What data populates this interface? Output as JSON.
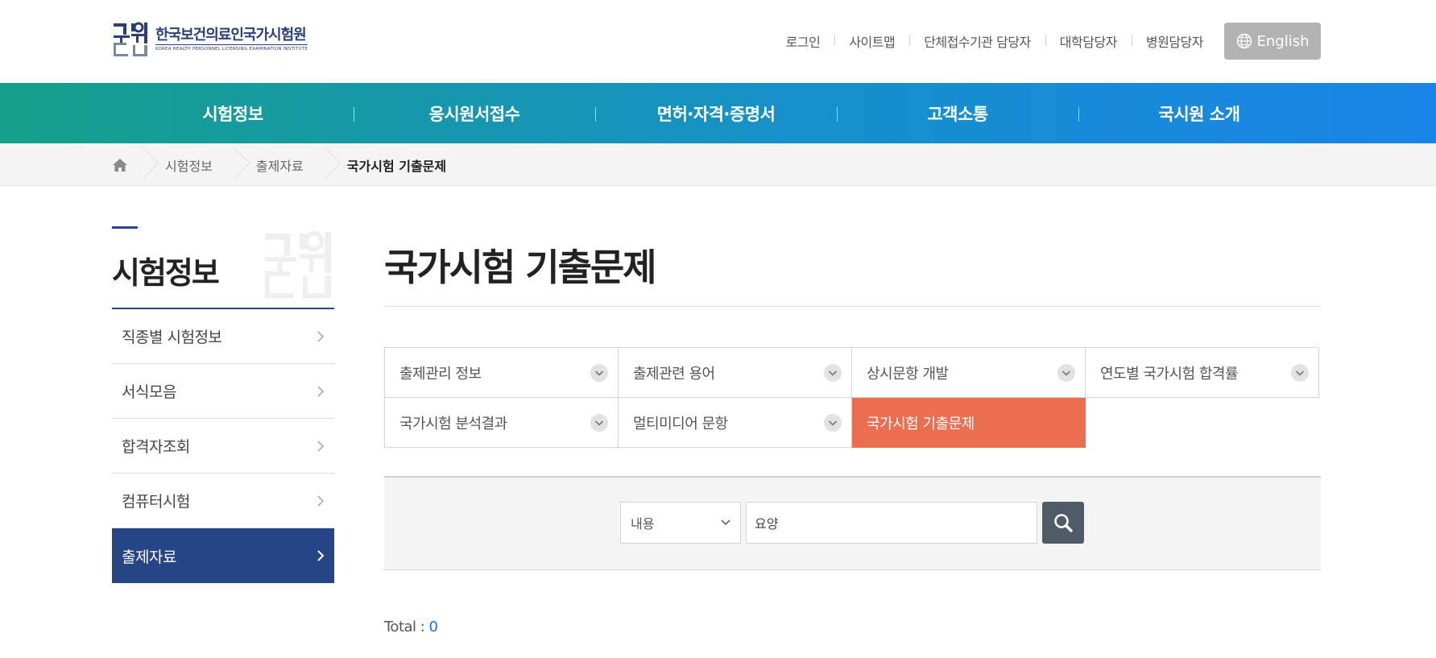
{
  "header": {
    "logo": {
      "name_kr": "한국보건의료인국가시험원",
      "name_en": "KOREA HEALTH PERSONNEL LICENSING EXAMINATION INSTITUTE",
      "mark": "국시원"
    },
    "util_links": [
      "로그인",
      "사이트맵",
      "단체접수기관 담당자",
      "대학담당자",
      "병원담당자"
    ],
    "english_label": "English"
  },
  "gnb": {
    "items": [
      "시험정보",
      "응시원서접수",
      "면허·자격·증명서",
      "고객소통",
      "국시원 소개"
    ]
  },
  "breadcrumb": {
    "items": [
      "시험정보",
      "출제자료",
      "국가시험 기출문제"
    ]
  },
  "lnb": {
    "title": "시험정보",
    "items": [
      {
        "label": "직종별 시험정보",
        "active": false
      },
      {
        "label": "서식모음",
        "active": false
      },
      {
        "label": "합격자조회",
        "active": false
      },
      {
        "label": "컴퓨터시험",
        "active": false
      },
      {
        "label": "출제자료",
        "active": true
      }
    ]
  },
  "main": {
    "page_title": "국가시험 기출문제",
    "tabs": [
      {
        "label": "출제관리 정보",
        "active": false
      },
      {
        "label": "출제관련 용어",
        "active": false
      },
      {
        "label": "상시문항 개발",
        "active": false
      },
      {
        "label": "연도별 국가시험 합격률",
        "active": false
      },
      {
        "label": "국가시험 분석결과",
        "active": false
      },
      {
        "label": "멀티미디어 문항",
        "active": false
      },
      {
        "label": "국가시험 기출문제",
        "active": true
      }
    ],
    "search": {
      "select_value": "내용",
      "input_value": "요양"
    },
    "total_label": "Total : ",
    "total_count": "0"
  },
  "colors": {
    "gnb_start": "#15a08a",
    "gnb_end": "#1a85e8",
    "lnb_active": "#264584",
    "tab_active": "#ec6e50",
    "search_button": "#4f5b66",
    "total_count": "#1a73d9"
  }
}
